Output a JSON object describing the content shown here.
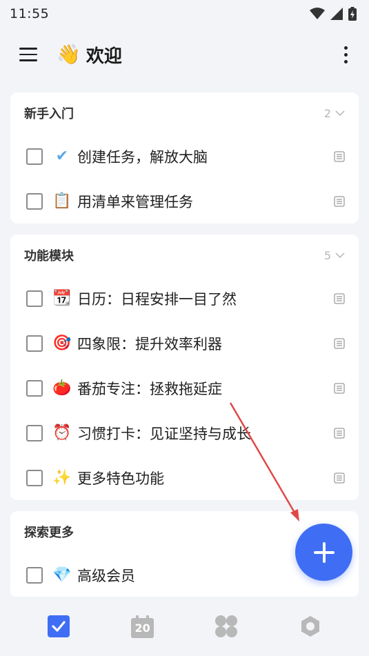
{
  "status": {
    "time": "11:55"
  },
  "header": {
    "emoji": "👋",
    "title": "欢迎"
  },
  "sections": [
    {
      "title": "新手入门",
      "count": "2",
      "tasks": [
        {
          "icon": "✔",
          "text": "创建任务，解放大脑"
        },
        {
          "icon": "📋",
          "text": "用清单来管理任务"
        }
      ]
    },
    {
      "title": "功能模块",
      "count": "5",
      "tasks": [
        {
          "icon": "📆",
          "text": "日历：日程安排一目了然"
        },
        {
          "icon": "🎯",
          "text": "四象限：提升效率利器"
        },
        {
          "icon": "🍅",
          "text": "番茄专注：拯救拖延症"
        },
        {
          "icon": "⏰",
          "text": "习惯打卡：见证坚持与成长"
        },
        {
          "icon": "✨",
          "text": "更多特色功能"
        }
      ]
    },
    {
      "title": "探索更多",
      "tasks": [
        {
          "icon": "💎",
          "text": "高级会员"
        }
      ]
    }
  ],
  "nav": {
    "calendar_day": "20"
  },
  "colors": {
    "accent": "#3f6ef4",
    "annotation_arrow": "#e04848"
  }
}
